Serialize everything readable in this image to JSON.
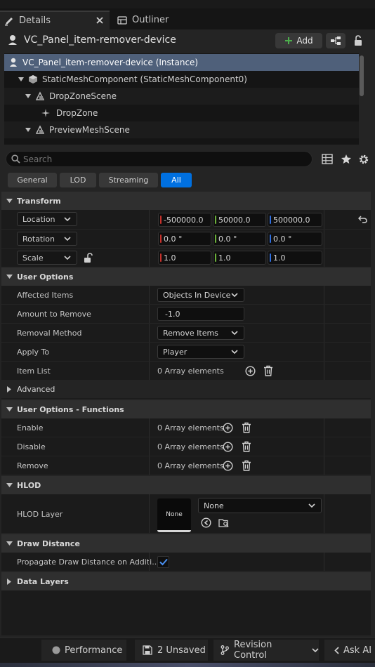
{
  "tabs": {
    "details": "Details",
    "outliner": "Outliner"
  },
  "header": {
    "title": "VC_Panel_item-remover-device",
    "add_label": "Add"
  },
  "tree": {
    "items": [
      {
        "label": "VC_Panel_item-remover-device (Instance)"
      },
      {
        "label": "StaticMeshComponent (StaticMeshComponent0)"
      },
      {
        "label": "DropZoneScene"
      },
      {
        "label": "DropZone"
      },
      {
        "label": "PreviewMeshScene"
      }
    ]
  },
  "search": {
    "placeholder": "Search"
  },
  "filters": {
    "general": "General",
    "lod": "LOD",
    "streaming": "Streaming",
    "all": "All"
  },
  "sections": {
    "transform": "Transform",
    "user_options": "User Options",
    "advanced": "Advanced",
    "user_options_functions": "User Options - Functions",
    "hlod": "HLOD",
    "draw_distance": "Draw Distance",
    "data_layers": "Data Layers"
  },
  "transform": {
    "location": {
      "label": "Location",
      "x": "-500000.0",
      "y": "50000.0",
      "z": "500000.0"
    },
    "rotation": {
      "label": "Rotation",
      "x": "0.0 °",
      "y": "0.0 °",
      "z": "0.0 °"
    },
    "scale": {
      "label": "Scale",
      "x": "1.0",
      "y": "1.0",
      "z": "1.0"
    }
  },
  "user_options": {
    "affected_items": {
      "label": "Affected Items",
      "value": "Objects In Device"
    },
    "amount_to_remove": {
      "label": "Amount to Remove",
      "value": "-1.0"
    },
    "removal_method": {
      "label": "Removal Method",
      "value": "Remove Items"
    },
    "apply_to": {
      "label": "Apply To",
      "value": "Player"
    },
    "item_list": {
      "label": "Item List",
      "value": "0 Array elements"
    }
  },
  "functions": {
    "enable": {
      "label": "Enable",
      "value": "0 Array elements"
    },
    "disable": {
      "label": "Disable",
      "value": "0 Array elements"
    },
    "remove": {
      "label": "Remove",
      "value": "0 Array elements"
    }
  },
  "hlod": {
    "label": "HLOD Layer",
    "thumb": "None",
    "value": "None"
  },
  "draw_distance": {
    "label": "Propagate Draw Distance on Additi..."
  },
  "statusbar": {
    "performance": "Performance",
    "unsaved": "2 Unsaved",
    "revision": "Revision Control",
    "ask_ai": "Ask AI"
  },
  "colors": {
    "accent": "#0070e0",
    "x_axis": "#c8322c",
    "y_axis": "#6bb03a",
    "z_axis": "#2f6fe0",
    "selection": "#4f607a"
  }
}
